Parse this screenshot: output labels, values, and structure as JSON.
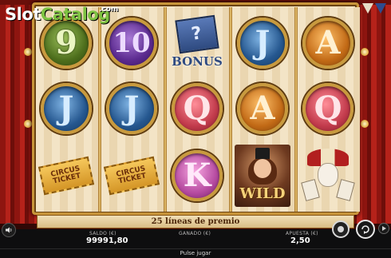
{
  "brand": {
    "slot": "Slot",
    "catalog": "Catalog",
    "com": ".com"
  },
  "reels": [
    [
      {
        "kind": "coin",
        "color": "green",
        "label": "9",
        "name": "nine-symbol"
      },
      {
        "kind": "coin",
        "color": "blue",
        "label": "J",
        "name": "jack-symbol"
      },
      {
        "kind": "ticket",
        "label": "CIRCUS TICKET",
        "name": "circus-ticket-symbol"
      }
    ],
    [
      {
        "kind": "coin",
        "color": "purple",
        "label": "10",
        "name": "ten-symbol"
      },
      {
        "kind": "coin",
        "color": "blue",
        "label": "J",
        "name": "jack-symbol"
      },
      {
        "kind": "ticket",
        "label": "CIRCUS TICKET",
        "name": "circus-ticket-symbol"
      }
    ],
    [
      {
        "kind": "bonus",
        "label": "BONUS",
        "name": "bonus-symbol"
      },
      {
        "kind": "coin",
        "color": "red",
        "label": "Q",
        "name": "queen-symbol"
      },
      {
        "kind": "coin",
        "color": "pink",
        "label": "K",
        "name": "king-symbol"
      }
    ],
    [
      {
        "kind": "coin",
        "color": "blue",
        "label": "J",
        "name": "jack-symbol"
      },
      {
        "kind": "coin",
        "color": "orange",
        "label": "A",
        "name": "ace-symbol"
      },
      {
        "kind": "wild",
        "label": "WILD",
        "name": "wild-symbol"
      }
    ],
    [
      {
        "kind": "coin",
        "color": "orange",
        "label": "A",
        "name": "ace-symbol"
      },
      {
        "kind": "coin",
        "color": "red",
        "label": "Q",
        "name": "queen-symbol"
      },
      {
        "kind": "joker",
        "label": "",
        "name": "joker-symbol"
      }
    ]
  ],
  "paylines": {
    "text": "25 líneas de premio"
  },
  "footer": {
    "balance_label": "SALDO (€)",
    "balance_value": "99991,80",
    "win_label": "GANADO (€)",
    "win_value": "",
    "bet_label": "APUESTA (€)",
    "bet_value": "2,50",
    "press_play": "Pulse jugar"
  },
  "icons": {
    "sound": "speaker-icon",
    "chip": "chip-icon",
    "spin": "spin-icon",
    "autoplay": "autoplay-icon"
  },
  "colors": {
    "frame_gold": "#c8953a",
    "curtain_red": "#b5221a",
    "logo_green": "#7ec242",
    "footer_bg": "#0e0e0f"
  }
}
